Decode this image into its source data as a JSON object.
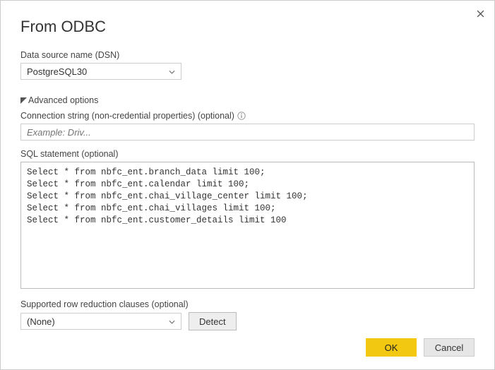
{
  "dialog": {
    "title": "From ODBC",
    "dsn": {
      "label": "Data source name (DSN)",
      "value": "PostgreSQL30"
    },
    "advanced": {
      "toggle_label": "Advanced options",
      "connection_string": {
        "label": "Connection string (non-credential properties) (optional)",
        "placeholder": "Example: Driv...",
        "value": ""
      },
      "sql_statement": {
        "label": "SQL statement (optional)",
        "value": "Select * from nbfc_ent.branch_data limit 100;\nSelect * from nbfc_ent.calendar limit 100;\nSelect * from nbfc_ent.chai_village_center limit 100;\nSelect * from nbfc_ent.chai_villages limit 100;\nSelect * from nbfc_ent.customer_details limit 100"
      },
      "row_reduction": {
        "label": "Supported row reduction clauses (optional)",
        "value": "(None)",
        "detect_label": "Detect"
      }
    },
    "buttons": {
      "ok": "OK",
      "cancel": "Cancel"
    }
  }
}
